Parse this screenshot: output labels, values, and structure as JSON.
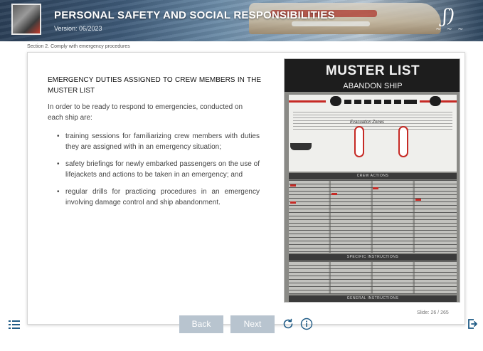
{
  "header": {
    "title": "PERSONAL SAFETY AND SOCIAL RESPONSIBILITIES",
    "version": "Version: 06/2023"
  },
  "breadcrumb": "Section 2. Comply with emergency procedures",
  "content": {
    "heading": "EMERGENCY DUTIES ASSIGNED TO CREW MEMBERS IN THE MUSTER LIST",
    "intro": "In order to be ready to respond to emergencies, conducted on each ship are:",
    "bullets": [
      "training sessions for familiarizing crew members with duties they are assigned with in an emergency situation;",
      "safety briefings for newly embarked passengers on the use of lifejackets and actions to be taken in an emergency; and",
      "regular drills for practicing procedures in an emergency involving damage control and ship abandonment."
    ]
  },
  "muster_image": {
    "title": "MUSTER LIST",
    "subtitle": "ABANDON SHIP",
    "zones_label": "Evacuation Zones",
    "crew_actions": "CREW ACTIONS",
    "specific_instructions": "SPECIFIC INSTRUCTIONS",
    "general_instructions": "GENERAL INSTRUCTIONS"
  },
  "slide_counter": "Slide: 26 / 265",
  "footer": {
    "back_label": "Back",
    "next_label": "Next"
  },
  "colors": {
    "button_bg": "#b8c4cf",
    "icon_blue": "#1f5b86",
    "muster_red": "#c62a25"
  }
}
